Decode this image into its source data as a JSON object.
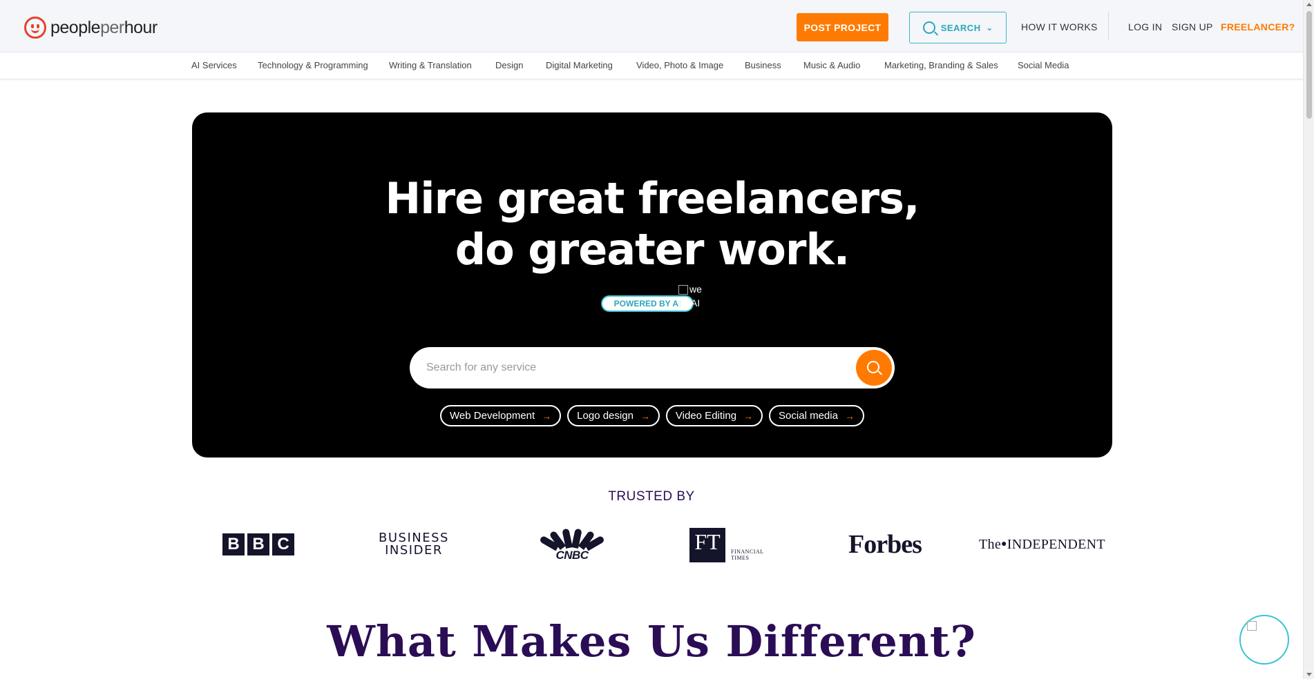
{
  "header": {
    "logo_text_main": "people",
    "logo_text_light": "per",
    "logo_text_end": "hour",
    "post_project": "POST PROJECT",
    "search": "SEARCH",
    "how_it_works": "HOW IT WORKS",
    "log_in": "LOG IN",
    "sign_up": "SIGN UP",
    "freelancer": "FREELANCER?"
  },
  "categories": [
    "AI Services",
    "Technology & Programming",
    "Writing & Translation",
    "Design",
    "Digital Marketing",
    "Video, Photo & Image",
    "Business",
    "Music & Audio",
    "Marketing, Branding & Sales",
    "Social Media"
  ],
  "hero": {
    "title_line1": "Hire great freelancers,",
    "title_line2": "do greater work.",
    "ai_badge": "POWERED BY AI",
    "broken_img_alt_line1": "we",
    "broken_img_alt_line2": "by AI",
    "search_placeholder": "Search for any service",
    "chips": [
      "Web Development",
      "Logo design",
      "Video Editing",
      "Social media"
    ]
  },
  "trusted": {
    "heading": "TRUSTED BY",
    "brands": {
      "bbc": [
        "B",
        "B",
        "C"
      ],
      "business_insider_line1": "BUSINESS",
      "business_insider_line2": "INSIDER",
      "cnbc": "CNBC",
      "ft": "FT",
      "ft_small_line1": "FINANCIAL",
      "ft_small_line2": "TIMES",
      "forbes": "Forbes",
      "independent_the": "The",
      "independent_name": "INDEPENDENT"
    }
  },
  "section": {
    "title": "What Makes Us Different?"
  },
  "colors": {
    "brand_orange": "#ff7a00",
    "brand_red": "#e8402a",
    "accent_teal": "#3cb6c9",
    "heading_purple": "#2b0d55"
  }
}
